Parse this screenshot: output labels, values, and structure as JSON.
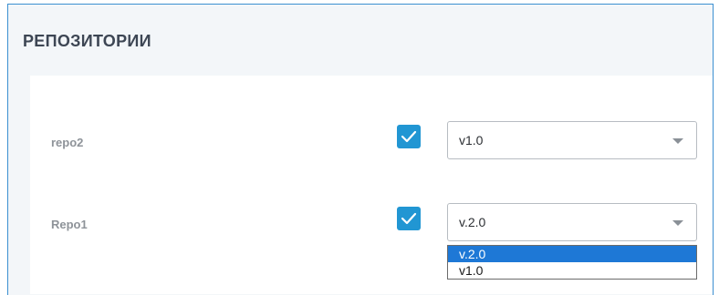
{
  "panel": {
    "title": "РЕПОЗИТОРИИ"
  },
  "rows": [
    {
      "label": "repo2",
      "checked": true,
      "selected_version": "v1.0"
    },
    {
      "label": "Repo1",
      "checked": true,
      "selected_version": "v.2.0"
    }
  ],
  "dropdown": {
    "open_for": "Repo1",
    "options": [
      {
        "label": "v.2.0",
        "highlighted": true
      },
      {
        "label": "v1.0",
        "highlighted": false
      }
    ]
  },
  "colors": {
    "accent": "#2196d3",
    "highlight": "#1e78d6",
    "window_border": "#3b8fd1"
  }
}
